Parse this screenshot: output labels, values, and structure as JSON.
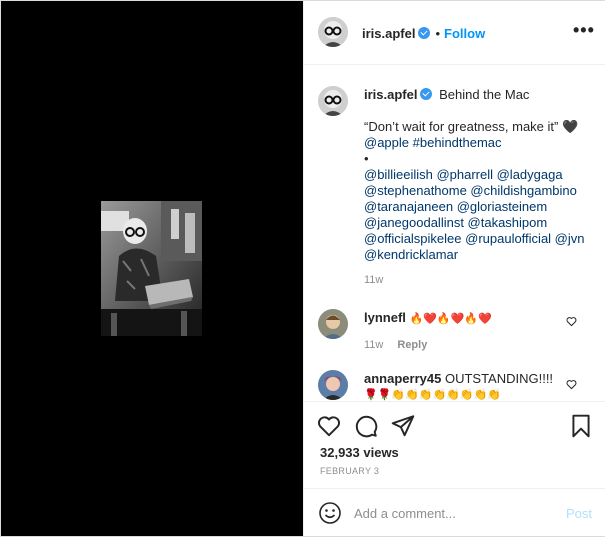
{
  "header": {
    "username": "iris.apfel",
    "separator": "•",
    "follow_label": "Follow",
    "more_icon": "ellipsis-icon",
    "more_label": "•••"
  },
  "caption": {
    "username": "iris.apfel",
    "title": "Behind the Mac",
    "quote": "“Don’t wait for greatness, make it”",
    "quote_emoji": "🖤",
    "tags_line": [
      "@apple",
      "#behindthemac"
    ],
    "bullet": "•",
    "mentions_text": "@billieeilish @pharrell @ladygaga @stephenathome @childishgambino @taranajaneen @gloriasteinem @janegoodallinst @takashipom @officialspikelee @rupaulofficial @jvn @kendricklamar",
    "time": "11w"
  },
  "comments": [
    {
      "username": "lynnefl",
      "text": "🔥❤️🔥❤️🔥❤️",
      "time": "11w",
      "reply_label": "Reply"
    },
    {
      "username": "annaperry45",
      "text": "OUTSTANDING!!!!",
      "emoji": "🌹🌹👏👏👏👏👏👏👏👏"
    }
  ],
  "actions": {
    "like_icon": "heart-icon",
    "comment_icon": "comment-icon",
    "share_icon": "share-icon",
    "save_icon": "bookmark-icon",
    "views": "32,933 views",
    "date": "FEBRUARY 3"
  },
  "add_comment": {
    "placeholder": "Add a comment...",
    "post_label": "Post",
    "emoji_icon": "smiley-icon"
  },
  "colors": {
    "follow": "#0095f6",
    "verified": "#3897f0",
    "mention": "#00376b",
    "muted": "#8e8e8e",
    "post_disabled": "#b2dffc"
  }
}
